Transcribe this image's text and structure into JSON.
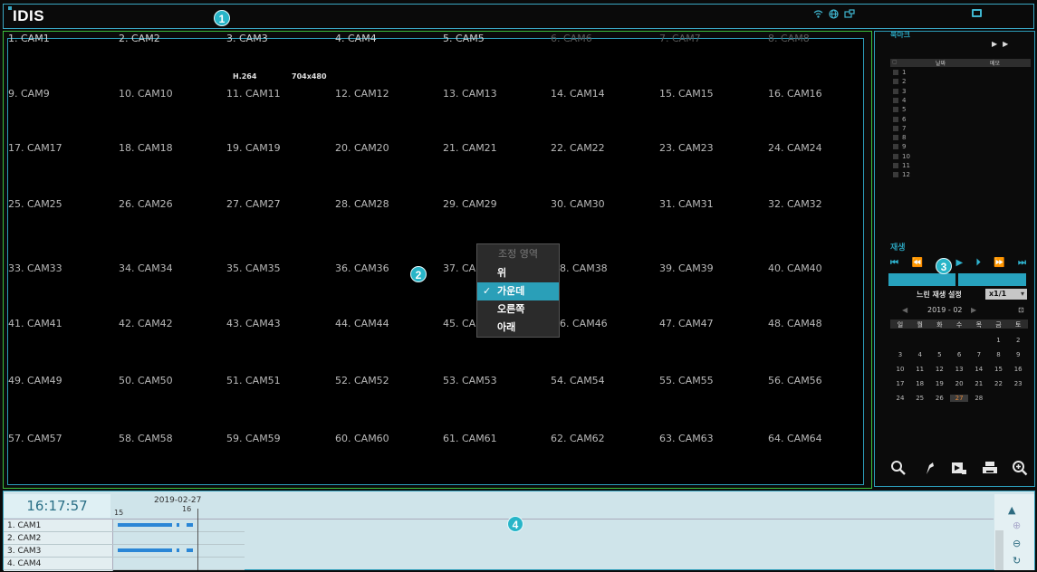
{
  "topbar": {
    "logo": "IDIS",
    "icons": [
      "wifi-icon",
      "globe-icon",
      "monitor-icon"
    ],
    "right_icon": "monitor-icon"
  },
  "callouts": [
    "1",
    "2",
    "3",
    "4"
  ],
  "cameras": [
    [
      "1. CAM1",
      "2. CAM2",
      "3. CAM3",
      "4. CAM4",
      "5. CAM5",
      "6. CAM6",
      "7. CAM7",
      "8. CAM8"
    ],
    [
      "9. CAM9",
      "10. CAM10",
      "11. CAM11",
      "12. CAM12",
      "13. CAM13",
      "14. CAM14",
      "15. CAM15",
      "16. CAM16"
    ],
    [
      "17. CAM17",
      "18. CAM18",
      "19. CAM19",
      "20. CAM20",
      "21. CAM21",
      "22. CAM22",
      "23. CAM23",
      "24. CAM24"
    ],
    [
      "25. CAM25",
      "26. CAM26",
      "27. CAM27",
      "28. CAM28",
      "29. CAM29",
      "30. CAM30",
      "31. CAM31",
      "32. CAM32"
    ],
    [
      "33. CAM33",
      "34. CAM34",
      "35. CAM35",
      "36. CAM36",
      "37. CAM37",
      "38. CAM38",
      "39. CAM39",
      "40. CAM40"
    ],
    [
      "41. CAM41",
      "42. CAM42",
      "43. CAM43",
      "44. CAM44",
      "45. CAM45",
      "46. CAM46",
      "47. CAM47",
      "48. CAM48"
    ],
    [
      "49. CAM49",
      "50. CAM50",
      "51. CAM51",
      "52. CAM52",
      "53. CAM53",
      "54. CAM54",
      "55. CAM55",
      "56. CAM56"
    ],
    [
      "57. CAM57",
      "58. CAM58",
      "59. CAM59",
      "60. CAM60",
      "61. CAM61",
      "62. CAM62",
      "63. CAM63",
      "64. CAM64"
    ]
  ],
  "cam_partial": {
    "r4c4": "37. CA",
    "r4c5": "8. CAM38",
    "r5c4": "45. CA",
    "r5c5": "6. CAM46"
  },
  "codec": {
    "format": "H.264",
    "resolution": "704x480"
  },
  "context_menu": {
    "title": "조정 영역",
    "items": [
      {
        "label": "위",
        "selected": false
      },
      {
        "label": "가운데",
        "selected": true
      },
      {
        "label": "오른쪽",
        "selected": false
      },
      {
        "label": "아래",
        "selected": false
      }
    ],
    "check": "✓"
  },
  "side": {
    "bookmark_title": "북마크",
    "col_date": "날짜",
    "col_memo": "메모",
    "rows": [
      "1",
      "2",
      "3",
      "4",
      "5",
      "6",
      "7",
      "8",
      "9",
      "10",
      "11",
      "12"
    ],
    "playback_label": "재생",
    "slow_label": "느린 재생 설정",
    "slow_value": "x1/1",
    "month": "2019 - 02",
    "weekdays": [
      "일",
      "월",
      "화",
      "수",
      "목",
      "금",
      "토"
    ],
    "weeks": [
      [
        "",
        "",
        "",
        "",
        "",
        "1",
        "2"
      ],
      [
        "3",
        "4",
        "5",
        "6",
        "7",
        "8",
        "9"
      ],
      [
        "10",
        "11",
        "12",
        "13",
        "14",
        "15",
        "16"
      ],
      [
        "17",
        "18",
        "19",
        "20",
        "21",
        "22",
        "23"
      ],
      [
        "24",
        "25",
        "26",
        "27",
        "28",
        "",
        ""
      ]
    ],
    "today": "27",
    "playback_buttons": [
      "⏮",
      "⏪",
      "◀",
      "▶",
      "⏩",
      "⏭"
    ],
    "tool_icons": [
      "search-icon",
      "export-icon",
      "clip-icon",
      "print-icon",
      "zoom-in-icon"
    ]
  },
  "timeline": {
    "clock": "16:17:57",
    "date": "2019-02-27",
    "tick_15": "15",
    "tick_16": "16",
    "rows": [
      "1. CAM1",
      "2. CAM2",
      "3. CAM3",
      "4. CAM4"
    ]
  }
}
